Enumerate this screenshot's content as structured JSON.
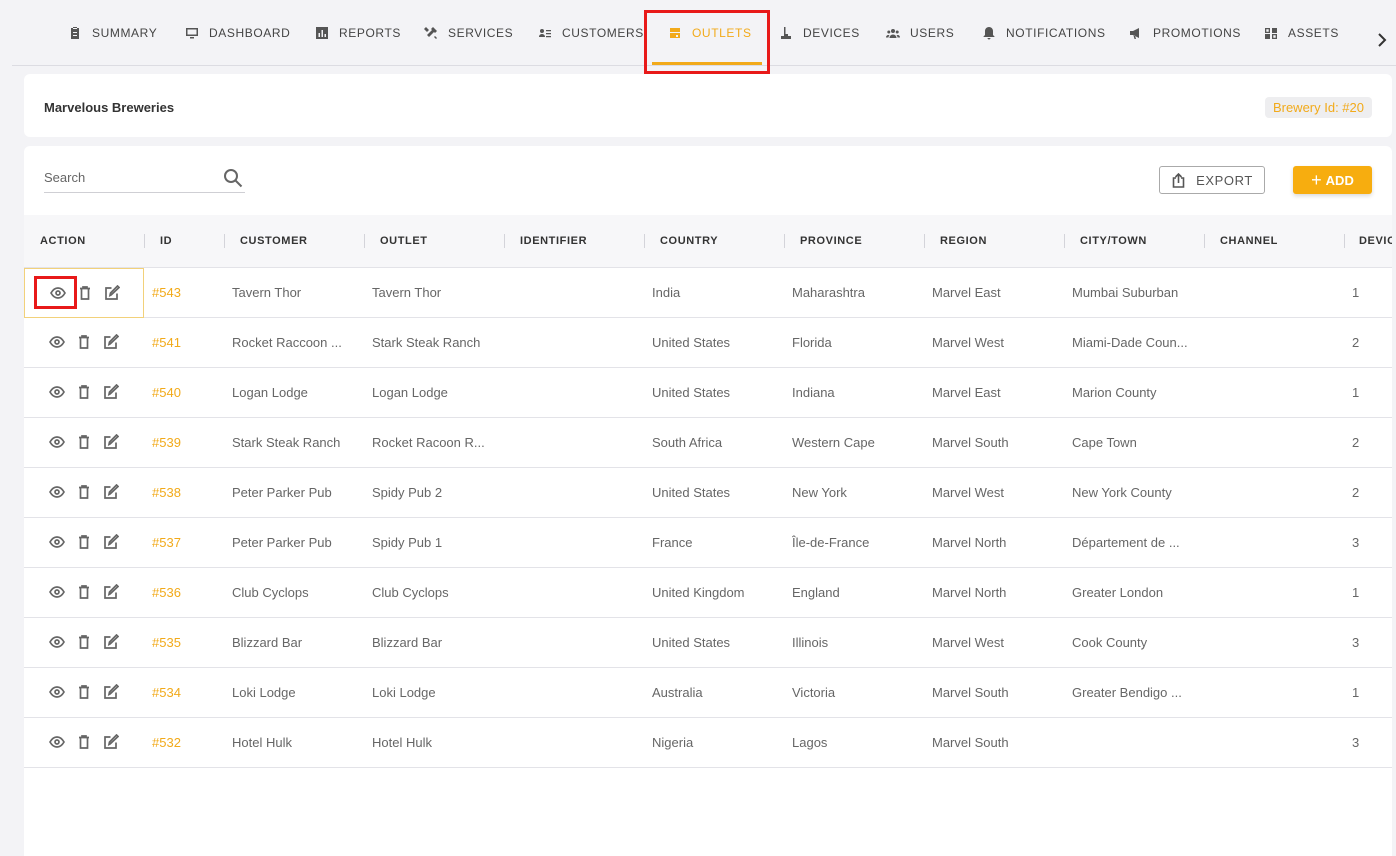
{
  "nav": {
    "tabs": [
      {
        "label": "SUMMARY",
        "icon": "clipboard-icon"
      },
      {
        "label": "DASHBOARD",
        "icon": "monitor-icon"
      },
      {
        "label": "REPORTS",
        "icon": "bar-chart-icon"
      },
      {
        "label": "SERVICES",
        "icon": "tools-icon"
      },
      {
        "label": "CUSTOMERS",
        "icon": "contact-list-icon"
      },
      {
        "label": "OUTLETS",
        "icon": "store-icon",
        "active": true
      },
      {
        "label": "DEVICES",
        "icon": "tap-icon"
      },
      {
        "label": "USERS",
        "icon": "users-icon"
      },
      {
        "label": "NOTIFICATIONS",
        "icon": "bell-icon"
      },
      {
        "label": "PROMOTIONS",
        "icon": "megaphone-icon"
      },
      {
        "label": "ASSETS",
        "icon": "assets-icon"
      }
    ],
    "next_icon": "chevron-right-icon"
  },
  "header": {
    "brewery_name": "Marvelous Breweries",
    "brewery_id": "Brewery Id: #20"
  },
  "toolbar": {
    "search_placeholder": "Search",
    "export_label": "EXPORT",
    "add_label": "ADD"
  },
  "colors": {
    "accent": "#f2aa1a",
    "add_button": "#f7ad0f",
    "highlight": "#e81919"
  },
  "table": {
    "columns": [
      "ACTION",
      "ID",
      "CUSTOMER",
      "OUTLET",
      "IDENTIFIER",
      "COUNTRY",
      "PROVINCE",
      "REGION",
      "CITY/TOWN",
      "CHANNEL",
      "DEVIC"
    ],
    "rows": [
      {
        "id": "#543",
        "customer": "Tavern Thor",
        "outlet": "Tavern Thor",
        "identifier": "",
        "country": "India",
        "province": "Maharashtra",
        "region": "Marvel East",
        "city": "Mumbai Suburban",
        "channel": "",
        "devices": "1"
      },
      {
        "id": "#541",
        "customer": "Rocket Raccoon ...",
        "outlet": "Stark Steak Ranch",
        "identifier": "",
        "country": "United States",
        "province": "Florida",
        "region": "Marvel West",
        "city": "Miami-Dade Coun...",
        "channel": "",
        "devices": "2"
      },
      {
        "id": "#540",
        "customer": "Logan Lodge",
        "outlet": "Logan Lodge",
        "identifier": "",
        "country": "United States",
        "province": "Indiana",
        "region": "Marvel East",
        "city": "Marion County",
        "channel": "",
        "devices": "1"
      },
      {
        "id": "#539",
        "customer": "Stark Steak Ranch",
        "outlet": "Rocket Racoon R...",
        "identifier": "",
        "country": "South Africa",
        "province": "Western Cape",
        "region": "Marvel South",
        "city": "Cape Town",
        "channel": "",
        "devices": "2"
      },
      {
        "id": "#538",
        "customer": "Peter Parker Pub",
        "outlet": "Spidy Pub 2",
        "identifier": "",
        "country": "United States",
        "province": "New York",
        "region": "Marvel West",
        "city": "New York County",
        "channel": "",
        "devices": "2"
      },
      {
        "id": "#537",
        "customer": "Peter Parker Pub",
        "outlet": "Spidy Pub 1",
        "identifier": "",
        "country": "France",
        "province": "Île-de-France",
        "region": "Marvel North",
        "city": "Département de ...",
        "channel": "",
        "devices": "3"
      },
      {
        "id": "#536",
        "customer": "Club Cyclops",
        "outlet": "Club Cyclops",
        "identifier": "",
        "country": "United Kingdom",
        "province": "England",
        "region": "Marvel North",
        "city": "Greater London",
        "channel": "",
        "devices": "1"
      },
      {
        "id": "#535",
        "customer": "Blizzard Bar",
        "outlet": "Blizzard Bar",
        "identifier": "",
        "country": "United States",
        "province": "Illinois",
        "region": "Marvel West",
        "city": "Cook County",
        "channel": "",
        "devices": "3"
      },
      {
        "id": "#534",
        "customer": "Loki Lodge",
        "outlet": "Loki Lodge",
        "identifier": "",
        "country": "Australia",
        "province": "Victoria",
        "region": "Marvel South",
        "city": "Greater Bendigo ...",
        "channel": "",
        "devices": "1"
      },
      {
        "id": "#532",
        "customer": "Hotel Hulk",
        "outlet": "Hotel Hulk",
        "identifier": "",
        "country": "Nigeria",
        "province": "Lagos",
        "region": "Marvel South",
        "city": "",
        "channel": "",
        "devices": "3"
      }
    ]
  }
}
